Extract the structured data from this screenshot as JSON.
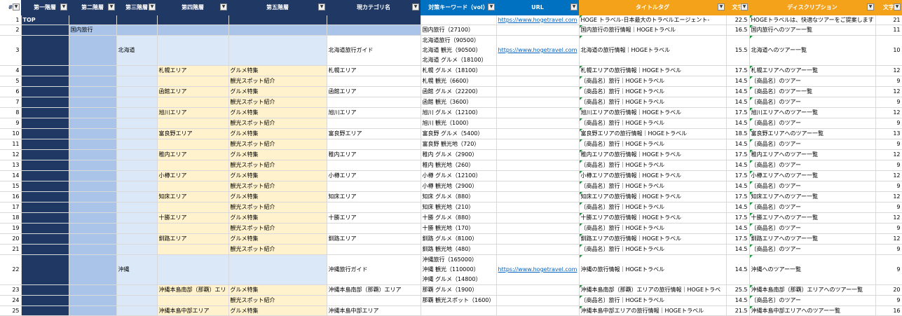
{
  "headers": [
    {
      "label": "#",
      "filter": "▼"
    },
    {
      "label": "第一階層",
      "filter": "▼"
    },
    {
      "label": "第二階層",
      "filter": "▼"
    },
    {
      "label": "第三階層",
      "filter": "▼"
    },
    {
      "label": "第四階層",
      "filter": "▼"
    },
    {
      "label": "第五階層",
      "filter": "▼"
    },
    {
      "label": "現カテゴリ名",
      "filter": "▼"
    },
    {
      "label": "対策キーワード（vol）",
      "filter": "▼"
    },
    {
      "label": "URL",
      "filter": "▼"
    },
    {
      "label": "タイトルタグ",
      "filter": "▼"
    },
    {
      "label": "文字",
      "filter": "▼"
    },
    {
      "label": "ディスクリプション",
      "filter": "▼"
    },
    {
      "label": "文字",
      "filter": "▼"
    }
  ],
  "rows": [
    {
      "n": "1",
      "l1": "TOP",
      "l2": "",
      "l3": "",
      "l4": "",
      "l5": "",
      "cat": "",
      "kw": [
        ""
      ],
      "url": "https://www.hogetravel.com",
      "title": "HOGE トラベル-日本最大のトラベルエージェント-",
      "tlen": "22.5",
      "desc": "HOGEトラベルは、快適なツアーをご提案します",
      "dlen": "21"
    },
    {
      "n": "2",
      "l1": "",
      "l2": "国内旅行",
      "l3": "",
      "l4": "",
      "l5": "",
      "cat": "",
      "kw": [
        "国内旅行（27100）"
      ],
      "url": "",
      "title": "国内旅行の旅行情報｜HOGEトラベル",
      "tlen": "16.5",
      "desc": "国内旅行へのツアー一覧",
      "dlen": "11"
    },
    {
      "n": "3",
      "l1": "",
      "l2": "",
      "l3": "北海道",
      "l4": "",
      "l5": "",
      "cat": "北海道旅行ガイド",
      "kw": [
        "北海道旅行（90500）",
        "北海道 観光（90500）",
        "北海道 グルメ（18100）"
      ],
      "url": "https://www.hogetravel.com",
      "title": "北海道の旅行情報｜HOGEトラベル",
      "tlen": "15.5",
      "desc": "北海道へのツアー一覧",
      "dlen": "10"
    },
    {
      "n": "4",
      "l1": "",
      "l2": "",
      "l3": "",
      "l4": "札幌エリア",
      "l5": "グルメ特集",
      "cat": "札幌エリア",
      "kw": [
        "札幌 グルメ（18100）"
      ],
      "url": "",
      "title": "札幌エリアの旅行情報｜HOGEトラベル",
      "tlen": "17.5",
      "desc": "札幌エリアへのツアー一覧",
      "dlen": "12"
    },
    {
      "n": "5",
      "l1": "",
      "l2": "",
      "l3": "",
      "l4": "",
      "l5": "観光スポット紹介",
      "cat": "",
      "kw": [
        "札幌 観光（6600）"
      ],
      "url": "",
      "title": "〔商品名〕旅行｜HOGEトラベル",
      "tlen": "14.5",
      "desc": "〔商品名〕のツアー",
      "dlen": "9"
    },
    {
      "n": "6",
      "l1": "",
      "l2": "",
      "l3": "",
      "l4": "函館エリア",
      "l5": "グルメ特集",
      "cat": "函館エリア",
      "kw": [
        "函館 グルメ（22200）"
      ],
      "url": "",
      "title": "〔商品名〕旅行｜HOGEトラベル",
      "tlen": "14.5",
      "desc": "〔商品名〕のツアー一覧",
      "dlen": "12"
    },
    {
      "n": "7",
      "l1": "",
      "l2": "",
      "l3": "",
      "l4": "",
      "l5": "観光スポット紹介",
      "cat": "",
      "kw": [
        "函館 観光（3600）"
      ],
      "url": "",
      "title": "〔商品名〕旅行｜HOGEトラベル",
      "tlen": "14.5",
      "desc": "〔商品名〕のツアー",
      "dlen": "9"
    },
    {
      "n": "8",
      "l1": "",
      "l2": "",
      "l3": "",
      "l4": "旭川エリア",
      "l5": "グルメ特集",
      "cat": "旭川エリア",
      "kw": [
        "旭川 グルメ（12100）"
      ],
      "url": "",
      "title": "旭川エリアの旅行情報｜HOGEトラベル",
      "tlen": "17.5",
      "desc": "旭川エリアへのツアー一覧",
      "dlen": "12"
    },
    {
      "n": "9",
      "l1": "",
      "l2": "",
      "l3": "",
      "l4": "",
      "l5": "観光スポット紹介",
      "cat": "",
      "kw": [
        "旭川 観光（1000）"
      ],
      "url": "",
      "title": "〔商品名〕旅行｜HOGEトラベル",
      "tlen": "14.5",
      "desc": "〔商品名〕のツアー",
      "dlen": "9"
    },
    {
      "n": "10",
      "l1": "",
      "l2": "",
      "l3": "",
      "l4": "富良野エリア",
      "l5": "グルメ特集",
      "cat": "富良野エリア",
      "kw": [
        "富良野 グルメ（5400）"
      ],
      "url": "",
      "title": "富良野エリアの旅行情報｜HOGEトラベル",
      "tlen": "18.5",
      "desc": "富良野エリアへのツアー一覧",
      "dlen": "13"
    },
    {
      "n": "11",
      "l1": "",
      "l2": "",
      "l3": "",
      "l4": "",
      "l5": "観光スポット紹介",
      "cat": "",
      "kw": [
        "富良野 観光地（720）"
      ],
      "url": "",
      "title": "〔商品名〕旅行｜HOGEトラベル",
      "tlen": "14.5",
      "desc": "〔商品名〕のツアー",
      "dlen": "9"
    },
    {
      "n": "12",
      "l1": "",
      "l2": "",
      "l3": "",
      "l4": "稚内エリア",
      "l5": "グルメ特集",
      "cat": "稚内エリア",
      "kw": [
        "稚内 グルメ（2900）"
      ],
      "url": "",
      "title": "稚内エリアの旅行情報｜HOGEトラベル",
      "tlen": "17.5",
      "desc": "稚内エリアへのツアー一覧",
      "dlen": "12"
    },
    {
      "n": "13",
      "l1": "",
      "l2": "",
      "l3": "",
      "l4": "",
      "l5": "観光スポット紹介",
      "cat": "",
      "kw": [
        "稚内 観光地（260）"
      ],
      "url": "",
      "title": "〔商品名〕旅行｜HOGEトラベル",
      "tlen": "14.5",
      "desc": "〔商品名〕のツアー",
      "dlen": "9"
    },
    {
      "n": "14",
      "l1": "",
      "l2": "",
      "l3": "",
      "l4": "小樽エリア",
      "l5": "グルメ特集",
      "cat": "小樽エリア",
      "kw": [
        "小樽 グルメ（12100）"
      ],
      "url": "",
      "title": "小樽エリアの旅行情報｜HOGEトラベル",
      "tlen": "17.5",
      "desc": "小樽エリアへのツアー一覧",
      "dlen": "12"
    },
    {
      "n": "15",
      "l1": "",
      "l2": "",
      "l3": "",
      "l4": "",
      "l5": "観光スポット紹介",
      "cat": "",
      "kw": [
        "小樽 観光地（2900）"
      ],
      "url": "",
      "title": "〔商品名〕旅行｜HOGEトラベル",
      "tlen": "14.5",
      "desc": "〔商品名〕のツアー",
      "dlen": "9"
    },
    {
      "n": "16",
      "l1": "",
      "l2": "",
      "l3": "",
      "l4": "知床エリア",
      "l5": "グルメ特集",
      "cat": "知床エリア",
      "kw": [
        "知床 グルメ（880）"
      ],
      "url": "",
      "title": "知床エリアの旅行情報｜HOGEトラベル",
      "tlen": "17.5",
      "desc": "知床エリアへのツアー一覧",
      "dlen": "12"
    },
    {
      "n": "17",
      "l1": "",
      "l2": "",
      "l3": "",
      "l4": "",
      "l5": "観光スポット紹介",
      "cat": "",
      "kw": [
        "知床 観光地（210）"
      ],
      "url": "",
      "title": "〔商品名〕旅行｜HOGEトラベル",
      "tlen": "14.5",
      "desc": "〔商品名〕のツアー",
      "dlen": "9"
    },
    {
      "n": "18",
      "l1": "",
      "l2": "",
      "l3": "",
      "l4": "十勝エリア",
      "l5": "グルメ特集",
      "cat": "十勝エリア",
      "kw": [
        "十勝 グルメ（880）"
      ],
      "url": "",
      "title": "十勝エリアの旅行情報｜HOGEトラベル",
      "tlen": "17.5",
      "desc": "十勝エリアへのツアー一覧",
      "dlen": "12"
    },
    {
      "n": "19",
      "l1": "",
      "l2": "",
      "l3": "",
      "l4": "",
      "l5": "観光スポット紹介",
      "cat": "",
      "kw": [
        "十勝 観光地（170）"
      ],
      "url": "",
      "title": "〔商品名〕旅行｜HOGEトラベル",
      "tlen": "14.5",
      "desc": "〔商品名〕のツアー",
      "dlen": "9"
    },
    {
      "n": "20",
      "l1": "",
      "l2": "",
      "l3": "",
      "l4": "釧路エリア",
      "l5": "グルメ特集",
      "cat": "釧路エリア",
      "kw": [
        "釧路 グルメ（8100）"
      ],
      "url": "",
      "title": "釧路エリアの旅行情報｜HOGEトラベル",
      "tlen": "17.5",
      "desc": "釧路エリアへのツアー一覧",
      "dlen": "12"
    },
    {
      "n": "21",
      "l1": "",
      "l2": "",
      "l3": "",
      "l4": "",
      "l5": "観光スポット紹介",
      "cat": "",
      "kw": [
        "釧路 観光地（480）"
      ],
      "url": "",
      "title": "〔商品名〕旅行｜HOGEトラベル",
      "tlen": "14.5",
      "desc": "〔商品名〕のツアー",
      "dlen": "9"
    },
    {
      "n": "22",
      "l1": "",
      "l2": "",
      "l3": "沖縄",
      "l4": "",
      "l5": "",
      "cat": "沖縄旅行ガイド",
      "kw": [
        "沖縄旅行（165000）",
        "沖縄 観光（110000）",
        "沖縄 グルメ（14800）"
      ],
      "url": "https://www.hogetravel.com",
      "title": "沖縄の旅行情報｜HOGEトラベル",
      "tlen": "14.5",
      "desc": "沖縄へのツアー一覧",
      "dlen": "9"
    },
    {
      "n": "23",
      "l1": "",
      "l2": "",
      "l3": "",
      "l4": "沖縄本島南部（那覇）エリ",
      "l5": "グルメ特集",
      "cat": "沖縄本島南部（那覇）エリア",
      "kw": [
        "那覇 グルメ（1900）"
      ],
      "url": "",
      "title": "沖縄本島南部（那覇）エリアの旅行情報｜HOGEトラベ",
      "tlen": "25.5",
      "desc": "沖縄本島南部（那覇）エリアへのツアー一覧",
      "dlen": "20"
    },
    {
      "n": "24",
      "l1": "",
      "l2": "",
      "l3": "",
      "l4": "",
      "l5": "観光スポット紹介",
      "cat": "",
      "kw": [
        "那覇 観光スポット（1600）"
      ],
      "url": "",
      "title": "〔商品名〕旅行｜HOGEトラベル",
      "tlen": "14.5",
      "desc": "〔商品名〕のツアー",
      "dlen": "9"
    },
    {
      "n": "25",
      "l1": "",
      "l2": "",
      "l3": "",
      "l4": "沖縄本島中部エリア",
      "l5": "グルメ特集",
      "cat": "沖縄本島中部エリア",
      "kw": [
        ""
      ],
      "url": "",
      "title": "沖縄本島中部エリアの旅行情報｜HOGEトラベル",
      "tlen": "21.5",
      "desc": "沖縄本島中部エリアへのツアー一覧",
      "dlen": "16"
    }
  ]
}
